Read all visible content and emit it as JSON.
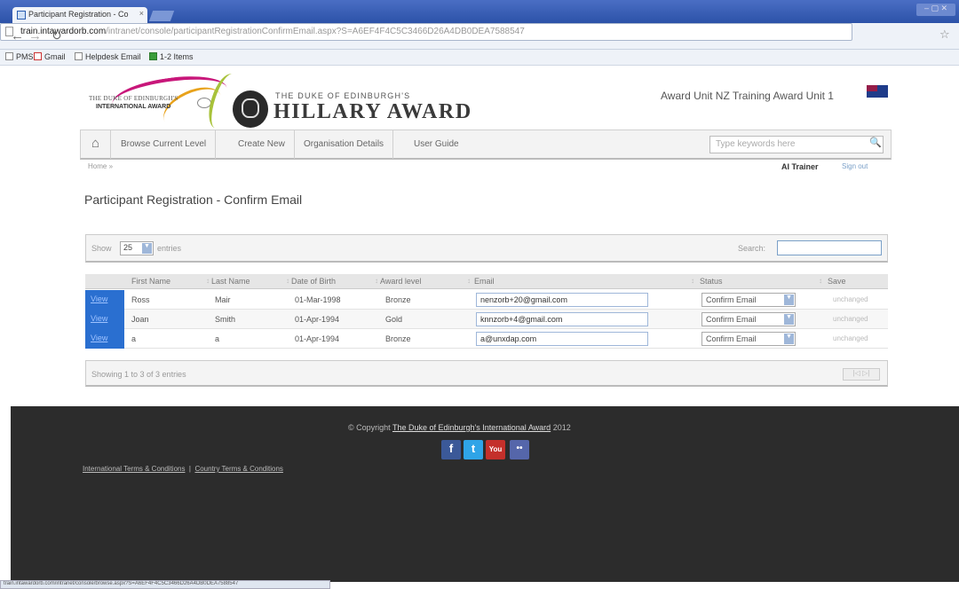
{
  "browser": {
    "tab_title": "Participant Registration - Co",
    "tab_close": "×",
    "url_host": "train.intawardorb.com",
    "url_path": "/intranet/console/participantRegistrationConfirmEmail.aspx?S=A6EF4F4C5C3466D26A4DB0DEA7588547",
    "bookmarks": [
      "PMS",
      "Gmail",
      "Helpdesk Email",
      "1-2 Items"
    ],
    "status_url": "train.intawardorb.com/intranet/console/browse.aspx?S=A6EF4F4C5C3466D26A4DB0DEA7588547"
  },
  "header": {
    "logo_line1": "THE DUKE OF EDINBURGH'S",
    "logo_line2": "INTERNATIONAL AWARD",
    "hillary_top": "THE DUKE OF EDINBURGH'S",
    "hillary_main": "HILLARY AWARD",
    "award_unit": "Award Unit NZ Training Award Unit 1"
  },
  "nav": {
    "home_icon": "⌂",
    "items": [
      "Browse Current Level",
      "Create New",
      "Organisation Details",
      "User Guide"
    ],
    "search_placeholder": "Type keywords here",
    "search_icon": "🔍"
  },
  "breadcrumb": "Home »",
  "user": {
    "name": "AI Trainer",
    "sign_out": "Sign out"
  },
  "page_title": "Participant Registration - Confirm Email",
  "table_controls": {
    "show_label": "Show",
    "page_size": "25",
    "entries_label": "entries",
    "search_label": "Search:"
  },
  "table": {
    "columns": [
      "First Name",
      "Last Name",
      "Date of Birth",
      "Award level",
      "Email",
      "Status",
      "Save"
    ],
    "rows": [
      {
        "view": "View",
        "first": "Ross",
        "last": "Mair",
        "dob": "01-Mar-1998",
        "level": "Bronze",
        "email": "nenzorb+20@gmail.com",
        "status": "Confirm Email",
        "save": "unchanged"
      },
      {
        "view": "View",
        "first": "Joan",
        "last": "Smith",
        "dob": "01-Apr-1994",
        "level": "Gold",
        "email": "knnzorb+4@gmail.com",
        "status": "Confirm Email",
        "save": "unchanged"
      },
      {
        "view": "View",
        "first": "a",
        "last": "a",
        "dob": "01-Apr-1994",
        "level": "Bronze",
        "email": "a@unxdap.com",
        "status": "Confirm Email",
        "save": "unchanged"
      }
    ],
    "showing": "Showing 1 to 3 of 3 entries",
    "pager": "|◁ ▷|"
  },
  "footer": {
    "copyright_prefix": "© Copyright",
    "copyright_link": "The Duke of Edinburgh's International Award",
    "copyright_year": "2012",
    "social": [
      "f",
      "t",
      "You",
      "••"
    ],
    "legal_left": "International Terms & Conditions",
    "legal_sep": "|",
    "legal_right": "Country Terms & Conditions"
  },
  "colors": {
    "view_button": "#2a6fd0",
    "footer_bg": "#2c2c2c",
    "accent_magenta": "#c8177a",
    "accent_green": "#a8c23a"
  }
}
